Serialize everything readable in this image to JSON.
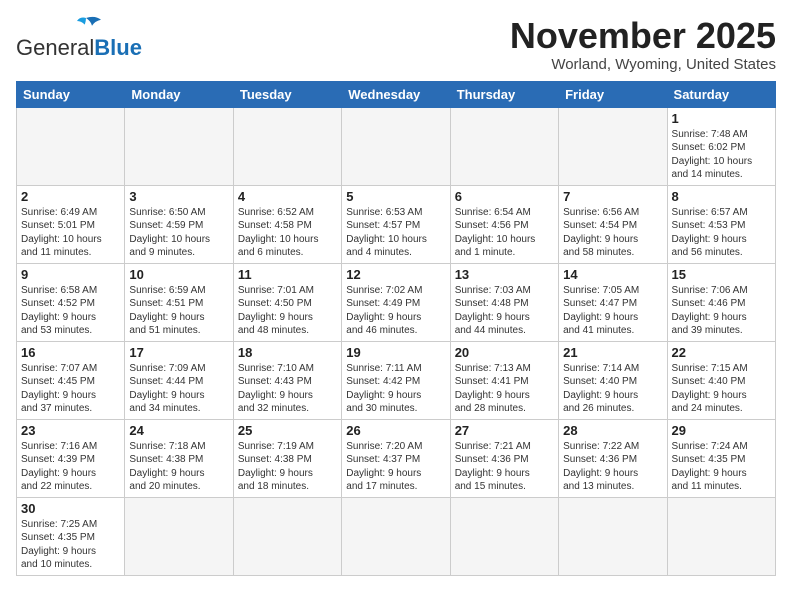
{
  "header": {
    "logo_general": "General",
    "logo_blue": "Blue",
    "month": "November 2025",
    "location": "Worland, Wyoming, United States"
  },
  "days_of_week": [
    "Sunday",
    "Monday",
    "Tuesday",
    "Wednesday",
    "Thursday",
    "Friday",
    "Saturday"
  ],
  "weeks": [
    [
      {
        "day": "",
        "info": ""
      },
      {
        "day": "",
        "info": ""
      },
      {
        "day": "",
        "info": ""
      },
      {
        "day": "",
        "info": ""
      },
      {
        "day": "",
        "info": ""
      },
      {
        "day": "",
        "info": ""
      },
      {
        "day": "1",
        "info": "Sunrise: 7:48 AM\nSunset: 6:02 PM\nDaylight: 10 hours\nand 14 minutes."
      }
    ],
    [
      {
        "day": "2",
        "info": "Sunrise: 6:49 AM\nSunset: 5:01 PM\nDaylight: 10 hours\nand 11 minutes."
      },
      {
        "day": "3",
        "info": "Sunrise: 6:50 AM\nSunset: 4:59 PM\nDaylight: 10 hours\nand 9 minutes."
      },
      {
        "day": "4",
        "info": "Sunrise: 6:52 AM\nSunset: 4:58 PM\nDaylight: 10 hours\nand 6 minutes."
      },
      {
        "day": "5",
        "info": "Sunrise: 6:53 AM\nSunset: 4:57 PM\nDaylight: 10 hours\nand 4 minutes."
      },
      {
        "day": "6",
        "info": "Sunrise: 6:54 AM\nSunset: 4:56 PM\nDaylight: 10 hours\nand 1 minute."
      },
      {
        "day": "7",
        "info": "Sunrise: 6:56 AM\nSunset: 4:54 PM\nDaylight: 9 hours\nand 58 minutes."
      },
      {
        "day": "8",
        "info": "Sunrise: 6:57 AM\nSunset: 4:53 PM\nDaylight: 9 hours\nand 56 minutes."
      }
    ],
    [
      {
        "day": "9",
        "info": "Sunrise: 6:58 AM\nSunset: 4:52 PM\nDaylight: 9 hours\nand 53 minutes."
      },
      {
        "day": "10",
        "info": "Sunrise: 6:59 AM\nSunset: 4:51 PM\nDaylight: 9 hours\nand 51 minutes."
      },
      {
        "day": "11",
        "info": "Sunrise: 7:01 AM\nSunset: 4:50 PM\nDaylight: 9 hours\nand 48 minutes."
      },
      {
        "day": "12",
        "info": "Sunrise: 7:02 AM\nSunset: 4:49 PM\nDaylight: 9 hours\nand 46 minutes."
      },
      {
        "day": "13",
        "info": "Sunrise: 7:03 AM\nSunset: 4:48 PM\nDaylight: 9 hours\nand 44 minutes."
      },
      {
        "day": "14",
        "info": "Sunrise: 7:05 AM\nSunset: 4:47 PM\nDaylight: 9 hours\nand 41 minutes."
      },
      {
        "day": "15",
        "info": "Sunrise: 7:06 AM\nSunset: 4:46 PM\nDaylight: 9 hours\nand 39 minutes."
      }
    ],
    [
      {
        "day": "16",
        "info": "Sunrise: 7:07 AM\nSunset: 4:45 PM\nDaylight: 9 hours\nand 37 minutes."
      },
      {
        "day": "17",
        "info": "Sunrise: 7:09 AM\nSunset: 4:44 PM\nDaylight: 9 hours\nand 34 minutes."
      },
      {
        "day": "18",
        "info": "Sunrise: 7:10 AM\nSunset: 4:43 PM\nDaylight: 9 hours\nand 32 minutes."
      },
      {
        "day": "19",
        "info": "Sunrise: 7:11 AM\nSunset: 4:42 PM\nDaylight: 9 hours\nand 30 minutes."
      },
      {
        "day": "20",
        "info": "Sunrise: 7:13 AM\nSunset: 4:41 PM\nDaylight: 9 hours\nand 28 minutes."
      },
      {
        "day": "21",
        "info": "Sunrise: 7:14 AM\nSunset: 4:40 PM\nDaylight: 9 hours\nand 26 minutes."
      },
      {
        "day": "22",
        "info": "Sunrise: 7:15 AM\nSunset: 4:40 PM\nDaylight: 9 hours\nand 24 minutes."
      }
    ],
    [
      {
        "day": "23",
        "info": "Sunrise: 7:16 AM\nSunset: 4:39 PM\nDaylight: 9 hours\nand 22 minutes."
      },
      {
        "day": "24",
        "info": "Sunrise: 7:18 AM\nSunset: 4:38 PM\nDaylight: 9 hours\nand 20 minutes."
      },
      {
        "day": "25",
        "info": "Sunrise: 7:19 AM\nSunset: 4:38 PM\nDaylight: 9 hours\nand 18 minutes."
      },
      {
        "day": "26",
        "info": "Sunrise: 7:20 AM\nSunset: 4:37 PM\nDaylight: 9 hours\nand 17 minutes."
      },
      {
        "day": "27",
        "info": "Sunrise: 7:21 AM\nSunset: 4:36 PM\nDaylight: 9 hours\nand 15 minutes."
      },
      {
        "day": "28",
        "info": "Sunrise: 7:22 AM\nSunset: 4:36 PM\nDaylight: 9 hours\nand 13 minutes."
      },
      {
        "day": "29",
        "info": "Sunrise: 7:24 AM\nSunset: 4:35 PM\nDaylight: 9 hours\nand 11 minutes."
      }
    ],
    [
      {
        "day": "30",
        "info": "Sunrise: 7:25 AM\nSunset: 4:35 PM\nDaylight: 9 hours\nand 10 minutes."
      },
      {
        "day": "",
        "info": ""
      },
      {
        "day": "",
        "info": ""
      },
      {
        "day": "",
        "info": ""
      },
      {
        "day": "",
        "info": ""
      },
      {
        "day": "",
        "info": ""
      },
      {
        "day": "",
        "info": ""
      }
    ]
  ]
}
